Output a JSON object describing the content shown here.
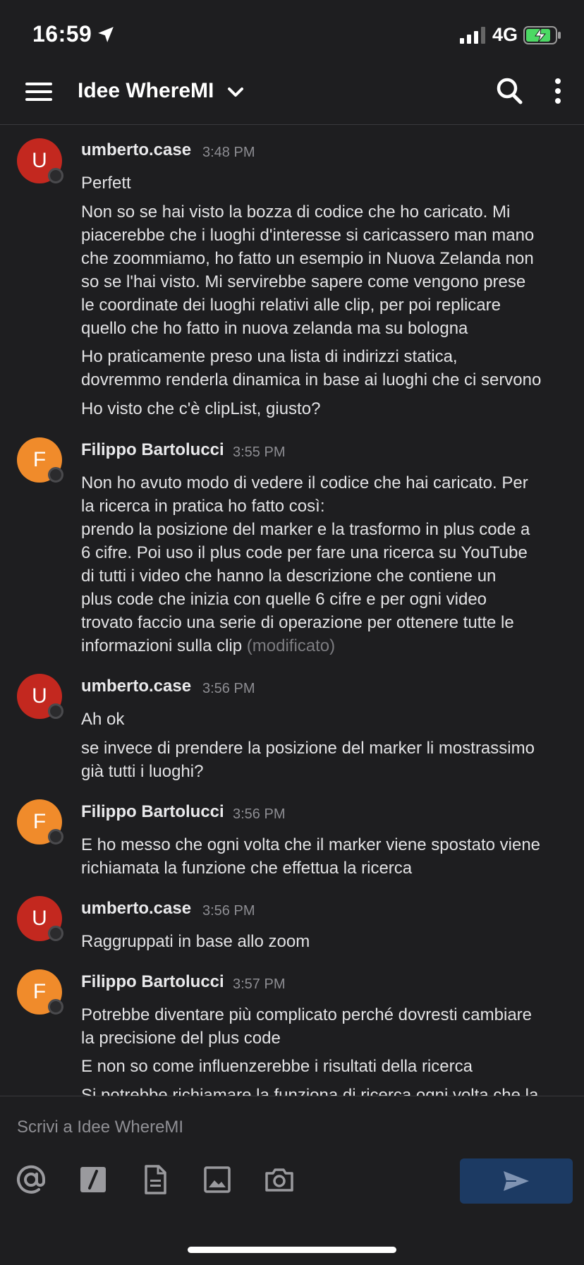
{
  "status_bar": {
    "time": "16:59",
    "network": "4G"
  },
  "header": {
    "channel_name": "Idee WhereMI"
  },
  "messages": [
    {
      "initial": "U",
      "sender": "umberto.case",
      "time": "3:48 PM",
      "lines": [
        "Perfett",
        "Non so se hai visto la bozza di codice che ho caricato. Mi",
        "piacerebbe che i luoghi d'interesse si caricassero man mano",
        "che zoommiamo, ho fatto un esempio in Nuova Zelanda non",
        "so se l'hai visto. Mi servirebbe sapere come vengono prese",
        "le coordinate dei luoghi relativi alle clip, per poi replicare",
        "quello che ho fatto in nuova zelanda ma su bologna",
        "Ho praticamente preso una lista di indirizzi statica,",
        "dovremmo renderla dinamica in base ai luoghi che ci servono",
        "Ho visto che c'è clipList, giusto?"
      ]
    },
    {
      "initial": "F",
      "sender": "Filippo Bartolucci",
      "time": "3:55 PM",
      "lines": [
        "Non ho avuto modo di vedere il codice che hai caricato. Per",
        "la ricerca in pratica ho fatto così:",
        "prendo la posizione del marker e la trasformo in plus code a",
        "6 cifre. Poi uso il plus code per fare una ricerca su YouTube",
        "di tutti i video che hanno la descrizione che contiene  un",
        "plus code che inizia con quelle 6 cifre e per ogni video",
        "trovato faccio una serie di operazione per ottenere tutte le",
        "informazioni sulla clip"
      ],
      "edited": "(modificato)"
    },
    {
      "initial": "U",
      "sender": "umberto.case",
      "time": "3:56 PM",
      "lines": [
        "Ah ok",
        "se invece di prendere la posizione del marker li mostrassimo",
        "già tutti i luoghi?"
      ]
    },
    {
      "initial": "F",
      "sender": "Filippo Bartolucci",
      "time": "3:56 PM",
      "lines": [
        "E ho messo che ogni volta che il marker viene spostato viene",
        "richiamata la funzione che effettua la ricerca"
      ]
    },
    {
      "initial": "U",
      "sender": "umberto.case",
      "time": "3:56 PM",
      "lines": [
        "Raggruppati in base allo zoom"
      ]
    },
    {
      "initial": "F",
      "sender": "Filippo Bartolucci",
      "time": "3:57 PM",
      "lines": [
        "Potrebbe diventare più complicato perché dovresti cambiare",
        "la precisione del plus code",
        "E non so come influenzerebbe i risultati della ricerca",
        "Si potrebbe richiamare la funziona di ricerca ogni volta che la"
      ]
    }
  ],
  "composer": {
    "placeholder": "Scrivi a Idee WhereMI"
  },
  "icons": {
    "menu": "hamburger-icon",
    "dropdown": "chevron-down-icon",
    "search": "search-icon",
    "more": "kebab-icon",
    "mention": "at-icon",
    "slash": "slash-command-icon",
    "file": "file-icon",
    "image": "image-icon",
    "camera": "camera-icon",
    "send": "send-icon"
  },
  "colors": {
    "background": "#1e1e20",
    "avatar_u": "#c3281f",
    "avatar_f": "#f08b2b",
    "send_button": "#1c3a63",
    "timestamp": "#8d8d92"
  }
}
